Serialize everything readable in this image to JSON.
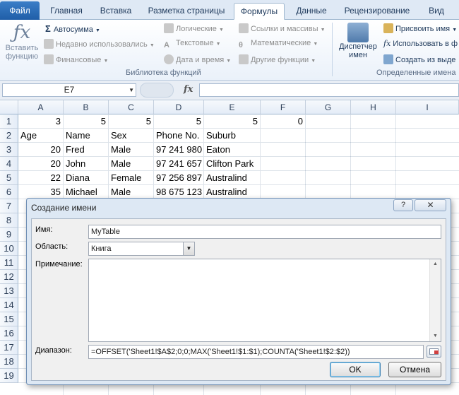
{
  "tabs": [
    {
      "label": "Файл"
    },
    {
      "label": "Главная"
    },
    {
      "label": "Вставка"
    },
    {
      "label": "Разметка страницы"
    },
    {
      "label": "Формулы"
    },
    {
      "label": "Данные"
    },
    {
      "label": "Рецензирование"
    },
    {
      "label": "Вид"
    }
  ],
  "ribbon": {
    "insert_function_1": "Вставить",
    "insert_function_2": "функцию",
    "autosum": "Автосумма",
    "recent": "Недавно использовались",
    "financial": "Финансовые",
    "logical": "Логические",
    "text": "Текстовые",
    "datetime": "Дата и время",
    "lookup": "Ссылки и массивы",
    "math": "Математические",
    "other": "Другие функции",
    "library_label": "Библиотека функций",
    "manager_1": "Диспетчер",
    "manager_2": "имен",
    "assign_name": "Присвоить имя",
    "use_in_formula": "Использовать в ф",
    "create_from_sel": "Создать из выде",
    "defined_names_label": "Определенные имена"
  },
  "formula_bar": {
    "name_box": "E7",
    "fx": "fx",
    "formula": ""
  },
  "grid": {
    "columns": [
      "A",
      "B",
      "C",
      "D",
      "E",
      "F",
      "G",
      "H",
      "I"
    ],
    "rows": [
      "1",
      "2",
      "3",
      "4",
      "5",
      "6",
      "7",
      "8",
      "9",
      "10",
      "11",
      "12",
      "13",
      "14",
      "15",
      "16",
      "17",
      "18",
      "19"
    ],
    "r1": [
      "3",
      "5",
      "5",
      "5",
      "5",
      "0"
    ],
    "r2": [
      "Age",
      "Name",
      "Sex",
      "Phone No.",
      "Suburb"
    ],
    "r3": [
      "20",
      "Fred",
      "Male",
      "97 241 980",
      "Eaton"
    ],
    "r4": [
      "20",
      "John",
      "Male",
      "97 241 657",
      "Clifton Park"
    ],
    "r5": [
      "22",
      "Diana",
      "Female",
      "97 256 897",
      "Australind"
    ],
    "r6": [
      "35",
      "Michael",
      "Male",
      "98 675 123",
      "Australind"
    ]
  },
  "dialog": {
    "title": "Создание имени",
    "help": "?",
    "close": "✕",
    "name_label": "Имя:",
    "name_value": "MyTable",
    "scope_label": "Область:",
    "scope_value": "Книга",
    "comment_label": "Примечание:",
    "comment_value": "",
    "range_label": "Диапазон:",
    "range_value": "=OFFSET('Sheet1!$A$2;0;0;MAX('Sheet1!$1:$1);COUNTA('Sheet1!$2:$2))",
    "ok": "OK",
    "cancel": "Отмена"
  },
  "colors": {
    "file_tab": "#2a6cb8",
    "ribbon_text": "#1e395b",
    "grid_line": "#dde3ea",
    "dialog_bg": "#dde8f4"
  }
}
